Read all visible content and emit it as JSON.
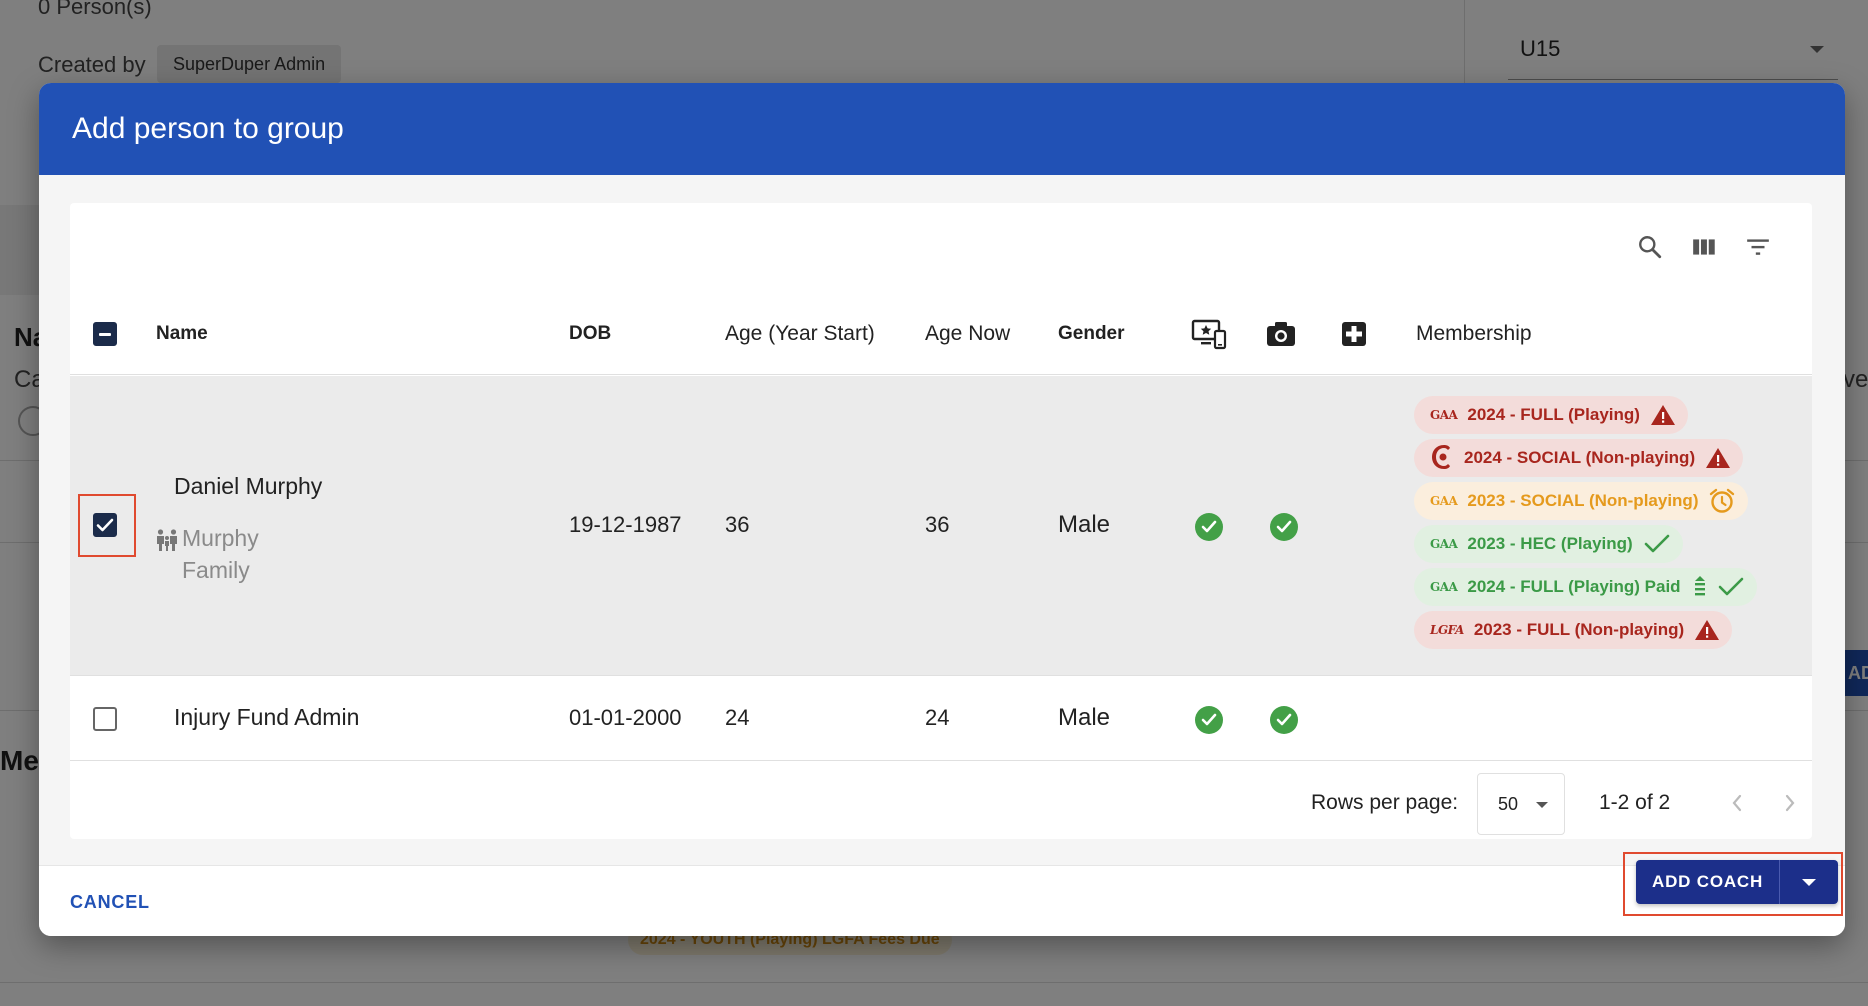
{
  "background": {
    "persons_count": "0 Person(s)",
    "created_by_label": "Created by",
    "created_by_value": "SuperDuper Admin",
    "age_group_select": "U15",
    "partial_heading": "Na",
    "partial_label": "Ca",
    "partial_right": "ve",
    "partial_me": "Me",
    "partial_tab": "AD",
    "faint_pill": "2024 - YOUTH (Playing) LGFA Fees Due"
  },
  "dialog": {
    "title": "Add person to group",
    "toolbar": {
      "search": "search-icon",
      "columns": "view-column-icon",
      "filter": "filter-icon"
    },
    "columns": {
      "name": "Name",
      "dob": "DOB",
      "age_year_start": "Age (Year Start)",
      "age_now": "Age Now",
      "gender": "Gender",
      "membership": "Membership"
    },
    "rows": [
      {
        "name": "Daniel Murphy",
        "family_line1": "Murphy",
        "family_line2": "Family",
        "dob": "19-12-1987",
        "age_year_start": "36",
        "age_now": "36",
        "gender": "Male",
        "selected": true,
        "memberships": [
          {
            "logo": "GAA",
            "label": "2024 - FULL (Playing)",
            "tone": "red",
            "status": "warning-icon"
          },
          {
            "logo": "CAMOGIE",
            "label": "2024 - SOCIAL (Non-playing)",
            "tone": "red",
            "status": "warning-icon"
          },
          {
            "logo": "HANDBALL",
            "label": "2023 - SOCIAL (Non-playing)",
            "tone": "amber",
            "status": "alarm-icon"
          },
          {
            "logo": "GAA",
            "label": "2023 - HEC (Playing)",
            "tone": "green",
            "status": "check-icon"
          },
          {
            "logo": "GAA",
            "label": "2024 - FULL (Playing) Paid",
            "tone": "green",
            "status": "installments-check-icon"
          },
          {
            "logo": "LGFA",
            "label": "2023 - FULL (Non-playing)",
            "tone": "red",
            "status": "warning-icon"
          }
        ]
      },
      {
        "name": "Injury Fund Admin",
        "dob": "01-01-2000",
        "age_year_start": "24",
        "age_now": "24",
        "gender": "Male",
        "selected": false
      }
    ],
    "pager": {
      "rows_per_page_label": "Rows per page:",
      "rows_per_page_value": "50",
      "range": "1-2 of 2"
    },
    "footer": {
      "cancel": "CANCEL",
      "add_coach": "ADD COACH"
    }
  },
  "colors": {
    "header_blue": "#2151b5",
    "button_navy": "#1c2f8a",
    "success_green": "#43a047",
    "warning_red": "#a8261e",
    "amber": "#e59a1d",
    "highlight": "#e04a2f"
  }
}
